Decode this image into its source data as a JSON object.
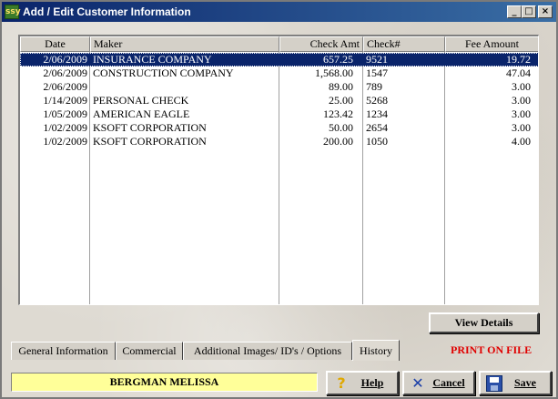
{
  "window": {
    "title": "Add / Edit Customer Information",
    "app_icon_text": "ssy"
  },
  "grid": {
    "columns": [
      "Date",
      "Maker",
      "Check Amt",
      "Check#",
      "Fee Amount"
    ],
    "rows": [
      {
        "date": "2/06/2009",
        "maker": "INSURANCE COMPANY",
        "amount": "657.25",
        "check_no": "9521",
        "fee": "19.72",
        "selected": true
      },
      {
        "date": "2/06/2009",
        "maker": "CONSTRUCTION COMPANY",
        "amount": "1,568.00",
        "check_no": "1547",
        "fee": "47.04"
      },
      {
        "date": "2/06/2009",
        "maker": "",
        "amount": "89.00",
        "check_no": "789",
        "fee": "3.00"
      },
      {
        "date": "1/14/2009",
        "maker": "PERSONAL CHECK",
        "amount": "25.00",
        "check_no": "5268",
        "fee": "3.00"
      },
      {
        "date": "1/05/2009",
        "maker": "AMERICAN EAGLE",
        "amount": "123.42",
        "check_no": "1234",
        "fee": "3.00"
      },
      {
        "date": "1/02/2009",
        "maker": "KSOFT CORPORATION",
        "amount": "50.00",
        "check_no": "2654",
        "fee": "3.00"
      },
      {
        "date": "1/02/2009",
        "maker": "KSOFT CORPORATION",
        "amount": "200.00",
        "check_no": "1050",
        "fee": "4.00"
      }
    ]
  },
  "buttons": {
    "view_details": "View Details",
    "help": "Help",
    "cancel": "Cancel",
    "save": "Save"
  },
  "tabs": [
    {
      "label": "General Information"
    },
    {
      "label": "Commercial"
    },
    {
      "label": "Additional Images/ ID's / Options"
    },
    {
      "label": "History",
      "active": true
    }
  ],
  "status": {
    "print_on_file": "PRINT ON FILE",
    "print_on_file_color": "#e00000"
  },
  "customer": {
    "name": "BERGMAN MELISSA",
    "name_bg_color": "#ffff99"
  }
}
